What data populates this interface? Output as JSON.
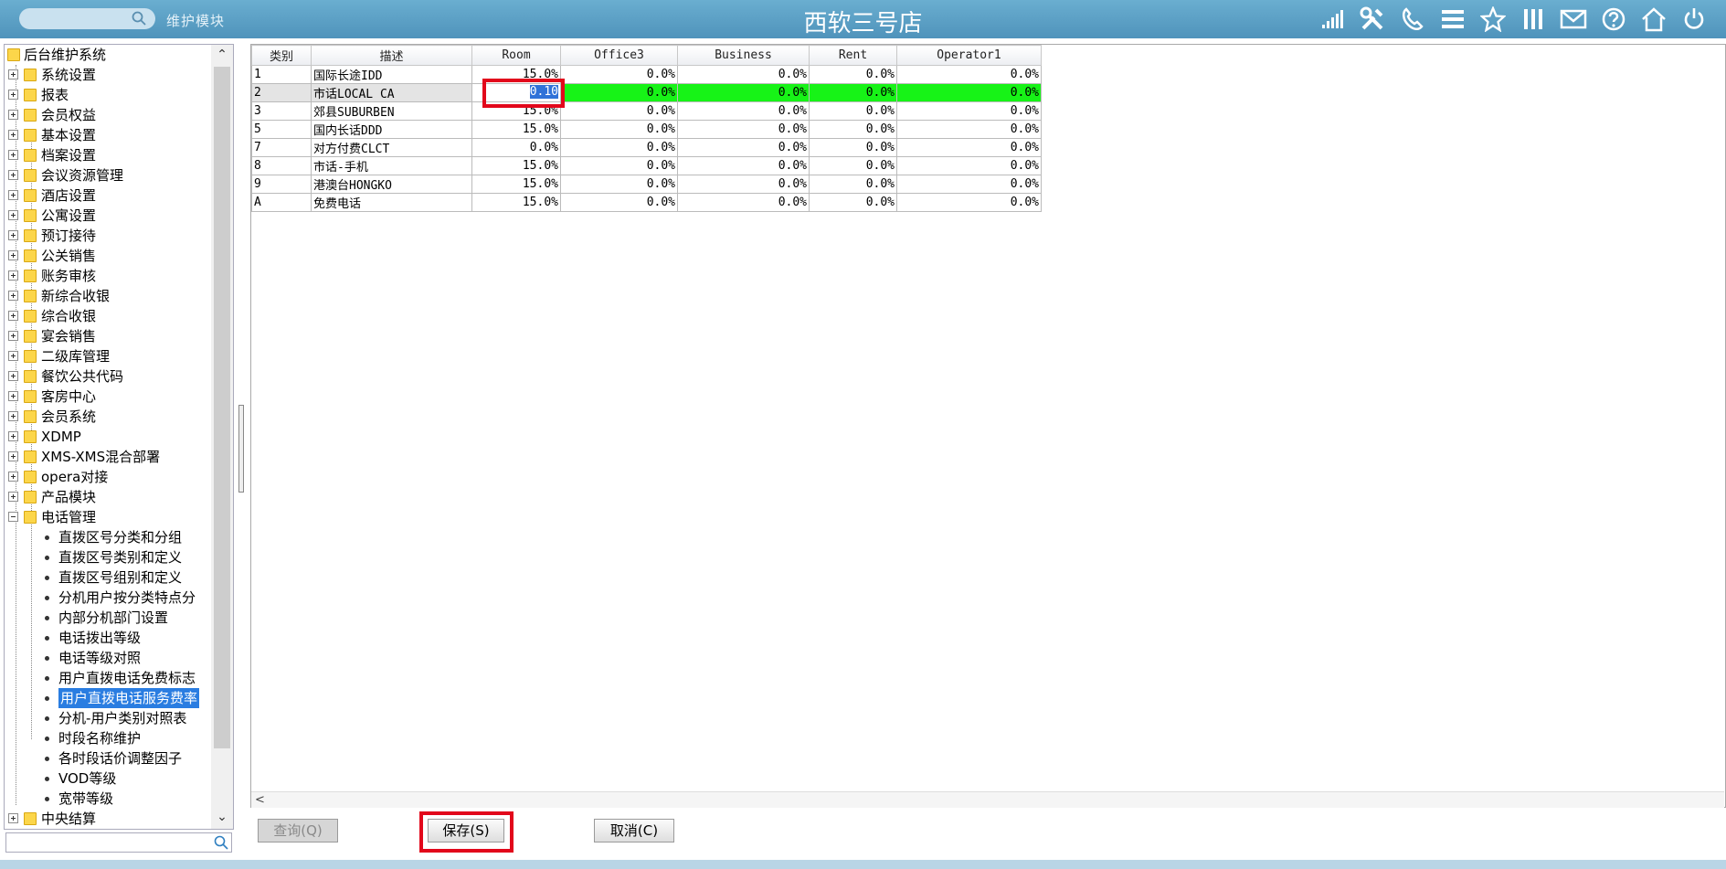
{
  "header": {
    "title": "西软三号店",
    "module_label": "维护模块",
    "icons": [
      "signal-icon",
      "tools-icon",
      "phone-icon",
      "menu-icon",
      "star-icon",
      "columns-icon",
      "mail-icon",
      "help-icon",
      "home-icon",
      "power-icon"
    ]
  },
  "tree": {
    "root": "后台维护系统",
    "items": [
      {
        "label": "系统设置"
      },
      {
        "label": "报表"
      },
      {
        "label": "会员权益"
      },
      {
        "label": "基本设置"
      },
      {
        "label": "档案设置"
      },
      {
        "label": "会议资源管理"
      },
      {
        "label": "酒店设置"
      },
      {
        "label": "公寓设置"
      },
      {
        "label": "预订接待"
      },
      {
        "label": "公关销售"
      },
      {
        "label": "账务审核"
      },
      {
        "label": "新综合收银"
      },
      {
        "label": "综合收银"
      },
      {
        "label": "宴会销售"
      },
      {
        "label": "二级库管理"
      },
      {
        "label": "餐饮公共代码"
      },
      {
        "label": "客房中心"
      },
      {
        "label": "会员系统"
      },
      {
        "label": "XDMP"
      },
      {
        "label": "XMS-XMS混合部署"
      },
      {
        "label": "opera对接"
      },
      {
        "label": "产品模块"
      }
    ],
    "expanded": {
      "label": "电话管理",
      "children": [
        {
          "label": "直拨区号分类和分组"
        },
        {
          "label": "直拨区号类别和定义"
        },
        {
          "label": "直拨区号组别和定义"
        },
        {
          "label": "分机用户按分类特点分"
        },
        {
          "label": "内部分机部门设置"
        },
        {
          "label": "电话拨出等级"
        },
        {
          "label": "电话等级对照"
        },
        {
          "label": "用户直拨电话免费标志"
        },
        {
          "label": "用户直拨电话服务费率"
        },
        {
          "label": "分机-用户类别对照表"
        },
        {
          "label": "时段名称维护"
        },
        {
          "label": "各时段话价调整因子"
        },
        {
          "label": "VOD等级"
        },
        {
          "label": "宽带等级"
        }
      ],
      "selected": "用户直拨电话服务费率"
    },
    "last": "中央结算"
  },
  "grid": {
    "columns": [
      "类别",
      "描述",
      "Room",
      "Office3",
      "Business",
      "Rent",
      "Operator1"
    ],
    "rows": [
      [
        "1",
        "国际长途IDD",
        "15.0%",
        "0.0%",
        "0.0%",
        "0.0%",
        "0.0%"
      ],
      [
        "2",
        "市话LOCAL CA",
        "",
        "0.0%",
        "0.0%",
        "0.0%",
        "0.0%"
      ],
      [
        "3",
        "郊县SUBURBEN",
        "15.0%",
        "0.0%",
        "0.0%",
        "0.0%",
        "0.0%"
      ],
      [
        "5",
        "国内长话DDD",
        "15.0%",
        "0.0%",
        "0.0%",
        "0.0%",
        "0.0%"
      ],
      [
        "7",
        "对方付费CLCT",
        "0.0%",
        "0.0%",
        "0.0%",
        "0.0%",
        "0.0%"
      ],
      [
        "8",
        "市话-手机",
        "15.0%",
        "0.0%",
        "0.0%",
        "0.0%",
        "0.0%"
      ],
      [
        "9",
        "港澳台HONGKO",
        "15.0%",
        "0.0%",
        "0.0%",
        "0.0%",
        "0.0%"
      ],
      [
        "A",
        "免费电话",
        "15.0%",
        "0.0%",
        "0.0%",
        "0.0%",
        "0.0%"
      ]
    ],
    "active_row": 1,
    "edit_value": "0.10"
  },
  "buttons": {
    "query": "查询(Q)",
    "save": "保存(S)",
    "cancel": "取消(C)"
  },
  "colors": {
    "active_row": "#17f317",
    "highlight_box": "#e2071b",
    "selection": "#2a7de1"
  }
}
